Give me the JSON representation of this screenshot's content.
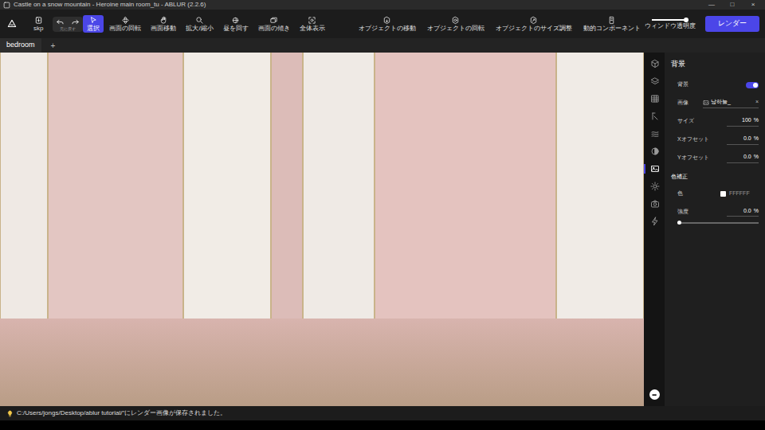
{
  "window": {
    "title": "Castle on a snow mountain - Heroine main room_tu - ABLUR (2.2.6)",
    "controls": [
      "—",
      "□",
      "×"
    ]
  },
  "toolbar": {
    "file_button": "skp",
    "undo_hint": "元に戻す",
    "tools": [
      {
        "label": "選択",
        "selected": true
      },
      {
        "label": "画面の回転",
        "selected": false
      },
      {
        "label": "画面移動",
        "selected": false
      },
      {
        "label": "拡大/縮小",
        "selected": false
      },
      {
        "label": "昼を回す",
        "selected": false
      },
      {
        "label": "画面の傾き",
        "selected": false
      },
      {
        "label": "全体表示",
        "selected": false
      }
    ],
    "object_tools": [
      {
        "label": "オブジェクトの移動",
        "selected": false
      },
      {
        "label": "オブジェクトの回転",
        "selected": false
      },
      {
        "label": "オブジェクトのサイズ調整",
        "selected": false
      },
      {
        "label": "動的コンポーネント",
        "selected": false
      }
    ],
    "transparency": {
      "label": "ウィンドウ透明度",
      "level": 0.95
    },
    "render_button": "レンダー"
  },
  "tabs": [
    {
      "label": "bedroom",
      "selected": true
    }
  ],
  "add_tab": "+",
  "side_icons": [
    {
      "selected": false
    },
    {
      "selected": false
    },
    {
      "selected": false
    },
    {
      "selected": false
    },
    {
      "selected": false
    },
    {
      "selected": false
    },
    {
      "selected": true
    },
    {
      "selected": false
    },
    {
      "selected": false
    },
    {
      "selected": false
    }
  ],
  "panel": {
    "title": "背景",
    "background": {
      "label": "背景",
      "on": true
    },
    "image": {
      "label": "画像",
      "value": "낭하늘_",
      "clear": "×"
    },
    "fields": [
      {
        "label": "サイズ",
        "value": "100",
        "unit": "%"
      },
      {
        "label": "Xオフセット",
        "value": "0.0",
        "unit": "%"
      },
      {
        "label": "Yオフセット",
        "value": "0.0",
        "unit": "%"
      }
    ],
    "color_section": {
      "title": "色補正",
      "color": {
        "label": "色",
        "value": "FFFFFF",
        "swatch": "#FFFFFF"
      },
      "strength": {
        "label": "強度",
        "value": "0.0",
        "unit": "%",
        "level": 0
      }
    }
  },
  "status_bar": {
    "message": "C:/Users/jongs/Desktop/ablur tutorial/\"にレンダー画像が保存されました。"
  }
}
